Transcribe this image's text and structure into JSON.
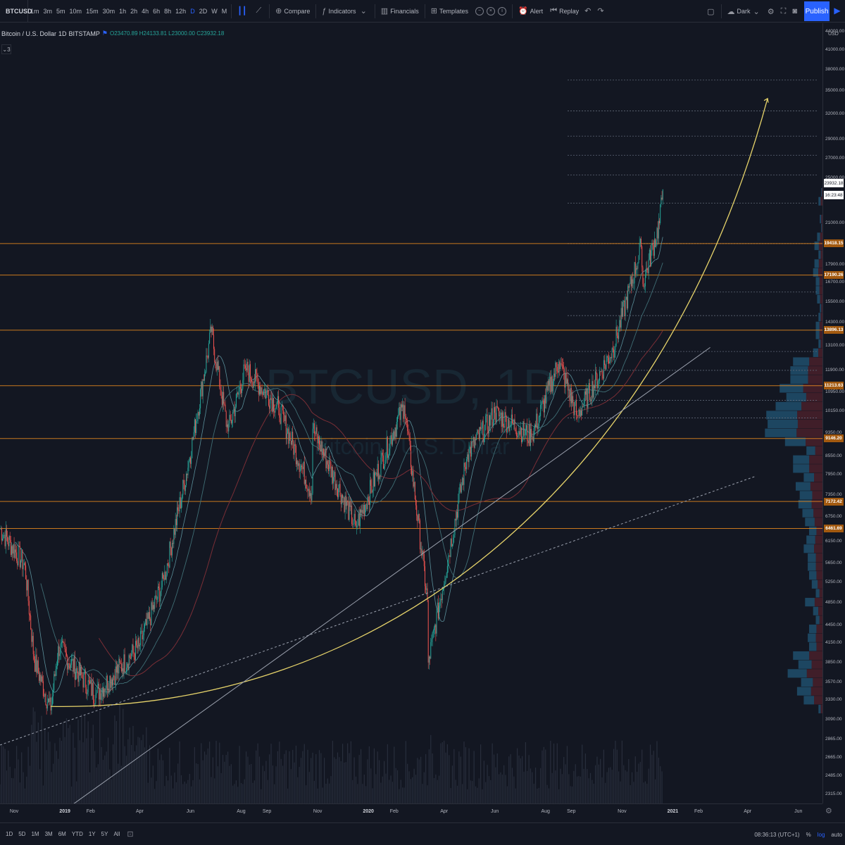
{
  "toolbar": {
    "symbol": "BTCUSD",
    "intervals": [
      "1m",
      "3m",
      "5m",
      "10m",
      "15m",
      "30m",
      "1h",
      "2h",
      "4h",
      "6h",
      "8h",
      "12h",
      "D",
      "2D",
      "W",
      "M"
    ],
    "active_interval": "D",
    "compare_label": "Compare",
    "indicators_label": "Indicators",
    "financials_label": "Financials",
    "templates_label": "Templates",
    "alert_label": "Alert",
    "replay_label": "Replay",
    "theme_label": "Dark",
    "publish_label": "Publish"
  },
  "legend": {
    "title": "Bitcoin / U.S. Dollar",
    "interval": "1D",
    "exchange": "BITSTAMP",
    "ohlc": "O23470.89  H24133.81  L23000.00  C23932.18",
    "indicator_count": "3"
  },
  "watermark": {
    "symbol": "BTCUSD, 1D",
    "name": "Bitcoin / U.S. Dollar"
  },
  "price_axis": {
    "currency": "USD",
    "top_value": "44000.00",
    "ticks": [
      "41000.00",
      "38000.00",
      "35000.00",
      "32000.00",
      "29000.00",
      "27000.00",
      "25000.00",
      "21000.00",
      "17900.00",
      "16700.00",
      "15500.00",
      "14300.00",
      "13100.00",
      "11900.00",
      "10950.00",
      "10150.00",
      "9350.00",
      "8550.00",
      "7950.00",
      "7350.00",
      "6750.00",
      "6150.00",
      "5650.00",
      "5250.00",
      "4850.00",
      "4450.00",
      "4150.00",
      "3850.00",
      "3570.00",
      "3330.00",
      "3090.00",
      "2865.00",
      "2665.00",
      "2485.00",
      "2315.00"
    ],
    "current_price": "23932.18",
    "countdown": "16:23:48",
    "highlighted_levels": [
      "19418.15",
      "17190.26",
      "13896.13",
      "11213.63",
      "9146.20",
      "7172.42",
      "6461.69"
    ]
  },
  "time_axis": {
    "labels": [
      "Nov",
      "2019",
      "Feb",
      "Apr",
      "Jun",
      "Aug",
      "Sep",
      "Nov",
      "2020",
      "Feb",
      "Apr",
      "Jun",
      "Aug",
      "Sep",
      "Nov",
      "2021",
      "Feb",
      "Apr",
      "Jun"
    ]
  },
  "bottom_bar": {
    "ranges": [
      "1D",
      "5D",
      "1M",
      "3M",
      "6M",
      "YTD",
      "1Y",
      "5Y",
      "All"
    ],
    "clock": "08:36:13 (UTC+1)",
    "percent": "%",
    "log": "log",
    "auto": "auto"
  },
  "colors": {
    "background": "#131722",
    "up": "#26a69a",
    "down": "#ef5350",
    "horizontal_level": "#e8891e",
    "curve": "#e6d36a",
    "trendline": "#9aa0ad",
    "accent": "#2962ff"
  },
  "chart_data": {
    "type": "candlestick",
    "symbol": "BTCUSD",
    "exchange": "BITSTAMP",
    "interval": "1D",
    "scale": "log",
    "ylim": [
      2315,
      44000
    ],
    "x_range": [
      "2018-10-15",
      "2021-06-30"
    ],
    "key_prices": [
      {
        "date": "2018-10-15",
        "price": 6450
      },
      {
        "date": "2018-11-14",
        "price": 5600
      },
      {
        "date": "2018-11-25",
        "price": 3900
      },
      {
        "date": "2018-12-15",
        "price": 3200
      },
      {
        "date": "2018-12-24",
        "price": 4100
      },
      {
        "date": "2019-02-07",
        "price": 3400
      },
      {
        "date": "2019-03-31",
        "price": 4100
      },
      {
        "date": "2019-04-30",
        "price": 5300
      },
      {
        "date": "2019-05-31",
        "price": 8500
      },
      {
        "date": "2019-06-26",
        "price": 13800
      },
      {
        "date": "2019-07-16",
        "price": 9400
      },
      {
        "date": "2019-08-06",
        "price": 12000
      },
      {
        "date": "2019-09-15",
        "price": 10300
      },
      {
        "date": "2019-10-25",
        "price": 7400
      },
      {
        "date": "2019-10-26",
        "price": 9500
      },
      {
        "date": "2019-12-17",
        "price": 6500
      },
      {
        "date": "2020-01-31",
        "price": 9400
      },
      {
        "date": "2020-02-13",
        "price": 10400
      },
      {
        "date": "2020-03-12",
        "price": 4900
      },
      {
        "date": "2020-03-13",
        "price": 3850
      },
      {
        "date": "2020-04-29",
        "price": 8600
      },
      {
        "date": "2020-06-01",
        "price": 10100
      },
      {
        "date": "2020-07-15",
        "price": 9200
      },
      {
        "date": "2020-08-17",
        "price": 12300
      },
      {
        "date": "2020-09-08",
        "price": 10000
      },
      {
        "date": "2020-10-21",
        "price": 12900
      },
      {
        "date": "2020-11-24",
        "price": 19200
      },
      {
        "date": "2020-11-26",
        "price": 16600
      },
      {
        "date": "2020-12-16",
        "price": 21000
      },
      {
        "date": "2020-12-20",
        "price": 23932
      }
    ],
    "horizontal_levels": [
      19418.15,
      17190.26,
      13896.13,
      11213.63,
      9146.2,
      7172.42,
      6461.69
    ],
    "dashed_levels": [
      36500,
      32400,
      29400,
      27300,
      25300,
      22700,
      19418,
      16100,
      14700,
      12800,
      11900,
      10600,
      9900
    ],
    "annotations": [
      {
        "type": "parabolic_curve",
        "color": "yellow",
        "from": {
          "date": "2018-12-15",
          "price": 3250
        },
        "to": {
          "date": "2021-04-25",
          "price": 34000
        }
      },
      {
        "type": "trend_line",
        "style": "solid",
        "from": {
          "date": "2018-11-25",
          "price": 2000
        },
        "to": {
          "date": "2021-02-15",
          "price": 13000
        }
      },
      {
        "type": "trend_line",
        "style": "dashed",
        "from": {
          "date": "2018-10-15",
          "price": 2800
        },
        "to": {
          "date": "2021-04-10",
          "price": 7900
        }
      }
    ]
  }
}
